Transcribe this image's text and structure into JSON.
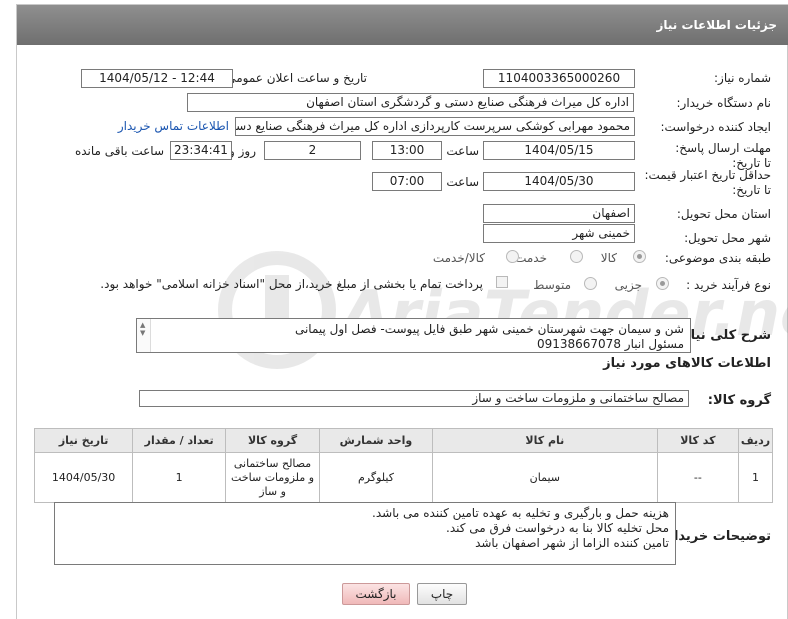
{
  "header": {
    "title": "جزئیات اطلاعات نیاز"
  },
  "fields": {
    "need_number_label": "شماره نیاز:",
    "need_number": "1104003365000260",
    "announce_label": "تاریخ و ساعت اعلان عمومی:",
    "announce_value": "1404/05/12 - 12:44",
    "buyer_label": "نام دستگاه خریدار:",
    "buyer_value": "اداره کل میراث فرهنگی  صنایع دستی و گردشگری استان اصفهان",
    "creator_label": "ایجاد کننده درخواست:",
    "creator_value": "محمود مهرابی کوشکی سرپرست کارپردازی اداره کل میراث فرهنگی  صنایع دست",
    "contact_link": "اطلاعات تماس خریدار",
    "deadline_label": "مهلت ارسال پاسخ: تا تاریخ:",
    "deadline_date": "1404/05/15",
    "time_label": "ساعت",
    "deadline_time": "13:00",
    "days_value": "2",
    "days_label": "روز و",
    "remaining_value": "23:34:41",
    "remaining_label": "ساعت باقی مانده",
    "price_validity_label": "حداقل تاریخ اعتبار قیمت: تا تاریخ:",
    "price_validity_date": "1404/05/30",
    "price_validity_time_label": "ساعت",
    "price_validity_time": "07:00",
    "province_label": "استان محل تحویل:",
    "province_value": "اصفهان",
    "city_label": "شهر محل تحویل:",
    "city_value": "خمینی شهر",
    "category_label": "طبقه بندی موضوعی:",
    "category_options": [
      "کالا",
      "خدمت",
      "کالا/خدمت"
    ],
    "process_label": "نوع فرآیند خرید :",
    "process_options": [
      "جزیی",
      "متوسط"
    ],
    "payment_note": "پرداخت تمام یا بخشی از مبلغ خرید،از محل \"اسناد خزانه اسلامی\" خواهد بود."
  },
  "description": {
    "label": "شرح کلی نیاز:",
    "lines": [
      "شن و سیمان جهت شهرستان خمینی شهر طبق فایل پیوست- فصل اول پیمانی",
      "مسئول انبار 09138667078"
    ]
  },
  "goods": {
    "section_title": "اطلاعات کالاهای مورد نیاز",
    "group_label": "گروه کالا:",
    "group_value": "مصالح ساختمانی و ملزومات ساخت و ساز",
    "columns": [
      "ردیف",
      "کد کالا",
      "نام کالا",
      "واحد شمارش",
      "گروه کالا",
      "تعداد / مقدار",
      "تاریخ نیاز"
    ],
    "rows": [
      {
        "index": "1",
        "code": "--",
        "name": "سیمان",
        "unit": "کیلوگرم",
        "group": "مصالح ساختمانی و ملزومات ساخت و ساز",
        "qty": "1",
        "date": "1404/05/30"
      }
    ]
  },
  "buyer_notes": {
    "label": "توضیحات خریدار:",
    "lines": [
      "هزینه حمل و بارگیری و تخلیه به عهده تامین کننده می باشد.",
      "محل تخلیه کالا بنا به درخواست فرق می کند.",
      "تامین کننده الزاما از شهر اصفهان باشد"
    ]
  },
  "buttons": {
    "print": "چاپ",
    "back": "بازگشت"
  },
  "watermark": {
    "text": "AriaTender.net"
  }
}
